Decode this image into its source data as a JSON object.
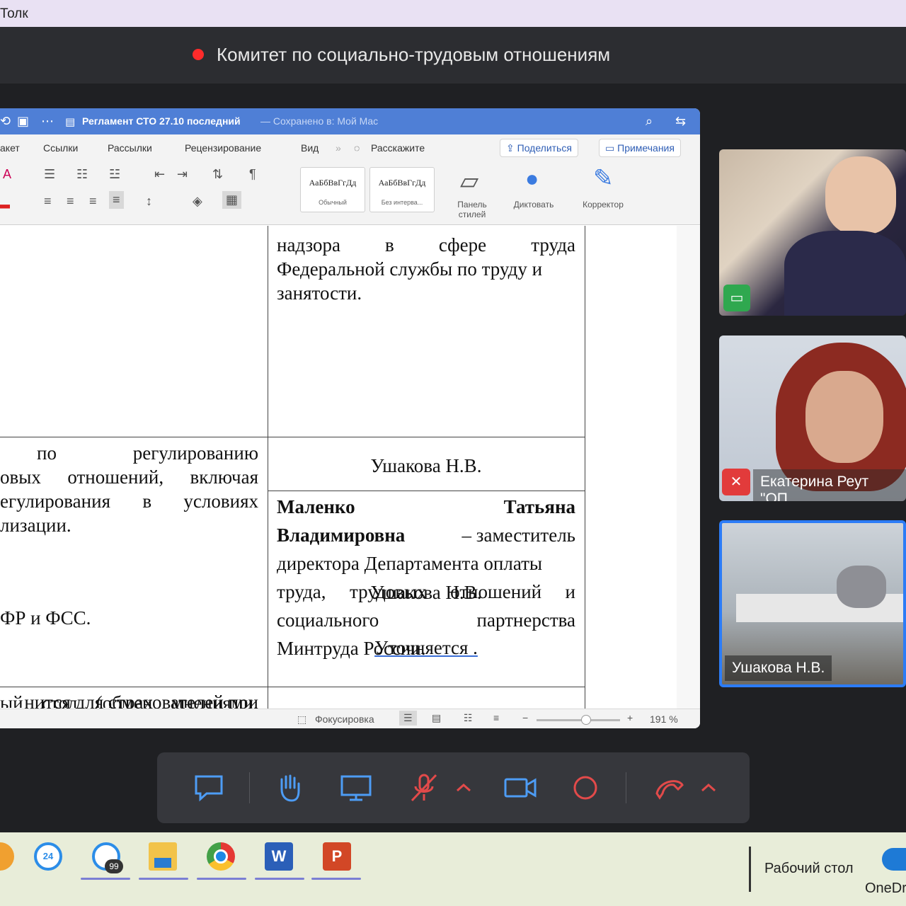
{
  "app": {
    "title": "Толк"
  },
  "meeting": {
    "title": "Комитет по социально-трудовым отношениям"
  },
  "word": {
    "doc_name": "Регламент СТО 27.10 последний",
    "saved_status": "— Сохранено в: Мой Mac",
    "tabs": [
      "акет",
      "Ссылки",
      "Рассылки",
      "Рецензирование",
      "Вид",
      "Расскажите"
    ],
    "share_label": "Поделиться",
    "comments_label": "Примечания",
    "styles": [
      {
        "sample": "АаБбВвГгДд",
        "name": "Обычный"
      },
      {
        "sample": "АаБбВвГгДд",
        "name": "Без интерва..."
      }
    ],
    "styles_pane_label_1": "Панель",
    "styles_pane_label_2": "стилей",
    "dictate_label": "Диктовать",
    "editor_label": "Корректор",
    "status": {
      "focus": "Фокусировка",
      "zoom": "191 %"
    }
  },
  "document": {
    "r1_right": [
      "надзора в сфере труда",
      "Федеральной службы по труду и",
      "занятости."
    ],
    "r2_left": [
      "по регулированию",
      "овых отношений, включая",
      "егулирования в условиях",
      "лизации."
    ],
    "r2_right_speaker": "Ушакова Н.В.",
    "r2_right_bold_1a": "Маленко",
    "r2_right_bold_1b": "Татьяна",
    "r2_right_bold_2": "Владимировна",
    "r2_right_text": [
      "– заместитель",
      "директора Департамента оплаты",
      "труда, трудовых отношений и",
      "социального партнерства",
      "Минтруда России."
    ],
    "r3_left": [
      "нится для страхователей при",
      "ФР и ФСС."
    ],
    "r3_right_speaker": "Ушакова Н.В.",
    "r3_right_note": "Уточняется .",
    "r4_left": "ый стол (обмен мнениями,"
  },
  "participants": [
    {
      "name": ""
    },
    {
      "name": "Екатерина Реут \"ОП"
    },
    {
      "name": "Ушакова Н.В."
    }
  ],
  "taskbar": {
    "badge_1": "24",
    "badge_2": "99",
    "desktop_label": "Рабочий стол",
    "onedrive_label": "OneDr"
  }
}
